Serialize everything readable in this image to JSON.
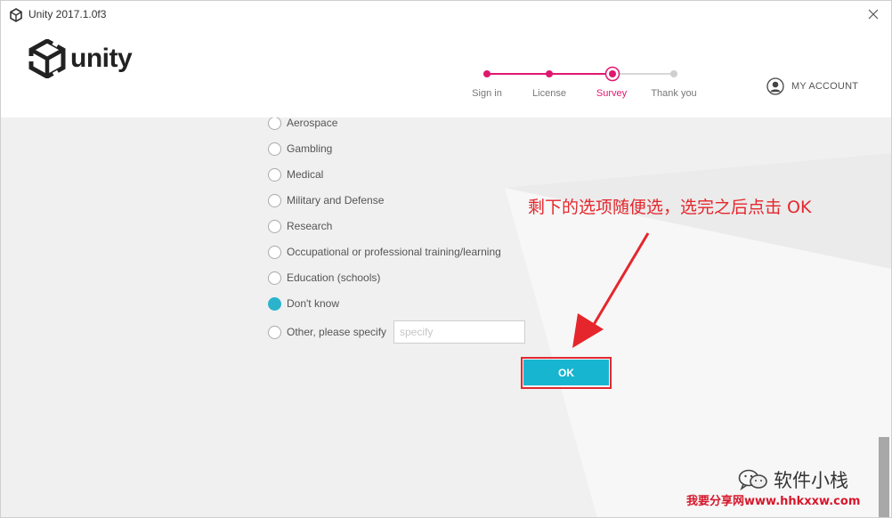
{
  "window": {
    "title": "Unity 2017.1.0f3"
  },
  "header": {
    "logo_text": "unity",
    "steps": [
      {
        "label": "Sign in",
        "state": "complete"
      },
      {
        "label": "License",
        "state": "complete"
      },
      {
        "label": "Survey",
        "state": "current"
      },
      {
        "label": "Thank you",
        "state": "pending"
      }
    ],
    "account_label": "MY ACCOUNT"
  },
  "survey": {
    "options": [
      {
        "label": "Aerospace",
        "checked": false
      },
      {
        "label": "Gambling",
        "checked": false
      },
      {
        "label": "Medical",
        "checked": false
      },
      {
        "label": "Military and Defense",
        "checked": false
      },
      {
        "label": "Research",
        "checked": false
      },
      {
        "label": "Occupational or professional training/learning",
        "checked": false
      },
      {
        "label": "Education (schools)",
        "checked": false
      },
      {
        "label": "Don't know",
        "checked": true
      },
      {
        "label": "Other, please specify",
        "checked": false
      }
    ],
    "specify_placeholder": "specify",
    "specify_value": "",
    "ok_label": "OK"
  },
  "annotation": {
    "text": "剩下的选项随便选，选完之后点击 OK"
  },
  "watermark": {
    "text": "软件小栈",
    "url": "我要分享网www.hhkxxw.com"
  },
  "colors": {
    "accent_pink": "#e0176f",
    "accent_cyan": "#17b5cf",
    "annotation_red": "#e5262c"
  }
}
